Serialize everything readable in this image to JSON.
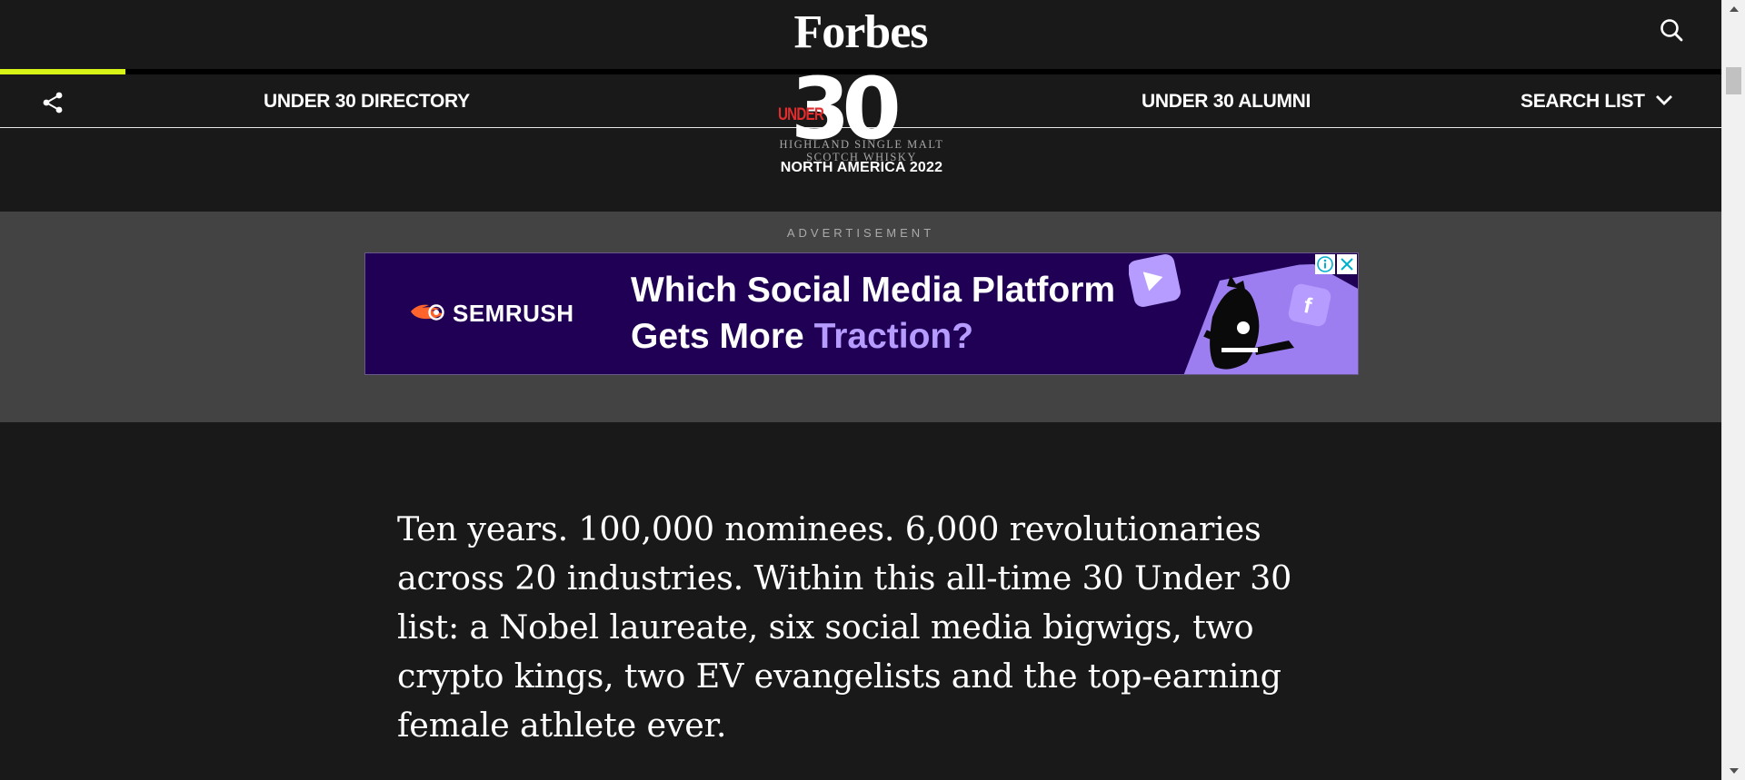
{
  "header": {
    "logo": "Forbes",
    "search_icon": "search-icon"
  },
  "reading_progress": 0.073,
  "nav": {
    "share_icon": "share-icon",
    "directory": "UNDER 30 DIRECTORY",
    "alumni": "UNDER 30 ALUMNI",
    "search_list": "SEARCH LIST",
    "search_list_icon": "chevron-down-icon"
  },
  "emblem": {
    "under": "UNDER",
    "number": "30",
    "sponsor_line1": "HIGHLAND SINGLE MALT",
    "sponsor_line2": "SCOTCH WHISKY",
    "region": "NORTH AMERICA 2022"
  },
  "ad": {
    "label": "ADVERTISEMENT",
    "brand": "SEMRUSH",
    "headline_line1": "Which Social Media Platform",
    "headline_line2_plain": "Gets More ",
    "headline_line2_accent": "Traction?",
    "info_icon": "info-icon",
    "close_icon": "close-icon",
    "colors": {
      "background": "#200055",
      "accent": "#b69cff",
      "brand": "#ff642d"
    }
  },
  "intro": {
    "text": "Ten years. 100,000 nominees. 6,000 revolutionaries across 20 industries. Within this all-time 30 Under 30 list: a Nobel laureate, six social media bigwigs, two crypto kings, two EV evangelists and the top-earning female athlete ever."
  },
  "colors": {
    "page_bg": "#1a1919",
    "ad_area_bg": "#444343",
    "progress": "#d8f417",
    "under_red": "#e12d2d"
  }
}
